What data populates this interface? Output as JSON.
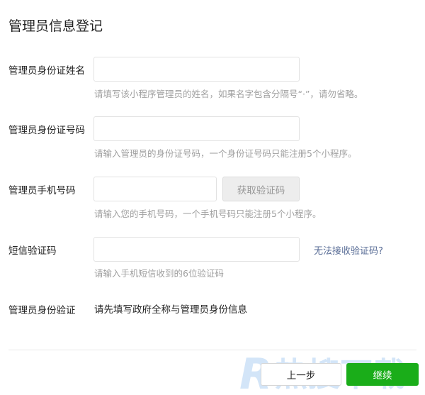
{
  "page": {
    "title": "管理员信息登记"
  },
  "fields": {
    "name": {
      "label": "管理员身份证姓名",
      "value": "",
      "hint": "请填写该小程序管理员的姓名，如果名字包含分隔号“·”，请勿省略。"
    },
    "id_number": {
      "label": "管理员身份证号码",
      "value": "",
      "hint": "请输入管理员的身份证号码，一个身份证号码只能注册5个小程序。"
    },
    "phone": {
      "label": "管理员手机号码",
      "value": "",
      "hint": "请输入您的手机号码，一个手机号码只能注册5个小程序。",
      "get_code_label": "获取验证码"
    },
    "sms_code": {
      "label": "短信验证码",
      "value": "",
      "hint": "请输入手机短信收到的6位验证码",
      "help_link": "无法接收验证码?"
    },
    "identity_verify": {
      "label": "管理员身份验证",
      "text": "请先填写政府全称与管理员身份信息"
    }
  },
  "footer": {
    "prev_label": "上一步",
    "next_label": "继续"
  },
  "colors": {
    "primary": "#1aad19",
    "link": "#576b95",
    "hint": "#a0a0a0"
  },
  "watermark_text": "热搜下载"
}
